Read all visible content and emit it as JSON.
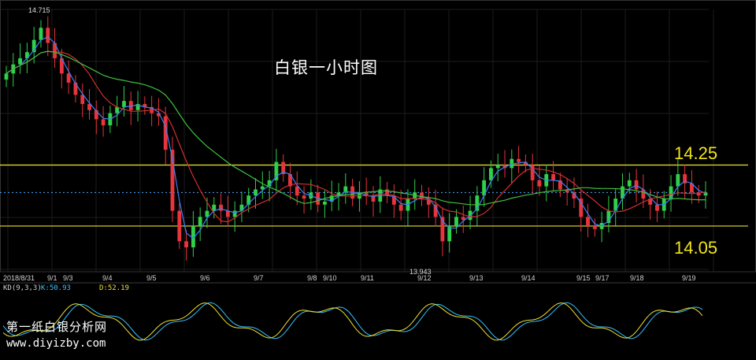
{
  "title": "白银一小时图",
  "levels": {
    "resistance": "14.25",
    "support": "14.05"
  },
  "annotations": {
    "high": "14.715",
    "low": "13.943"
  },
  "kd": {
    "name": "KD(9,3,3)",
    "k": "K:50.93",
    "d": "D:52.19"
  },
  "watermark": {
    "name": "第一纸白银分析网",
    "url": "www.diyizby.com"
  },
  "colors": {
    "up": "#2fd04a",
    "down": "#e8343c",
    "ma_fast": "#3b82f6",
    "ma_mid": "#d32f2f",
    "ma_slow": "#3fbf3f",
    "level_line": "#e6e030",
    "k_line": "#35c3ff",
    "d_line": "#f0e030"
  },
  "chart_data": {
    "type": "line",
    "series_kind": "candlestick",
    "x_tick_labels": [
      "2018/8/31",
      "9/1",
      "9/3",
      "9/4",
      "9/5",
      "9/6",
      "9/7",
      "9/8",
      "9/10",
      "9/11",
      "9/12",
      "9/13",
      "9/14",
      "9/15",
      "9/17",
      "9/18",
      "9/19"
    ],
    "close": [
      14.55,
      14.58,
      14.6,
      14.62,
      14.66,
      14.7,
      14.65,
      14.6,
      14.55,
      14.52,
      14.48,
      14.45,
      14.43,
      14.4,
      14.38,
      14.42,
      14.44,
      14.46,
      14.43,
      14.45,
      14.44,
      14.42,
      14.41,
      14.3,
      14.1,
      14.0,
      13.98,
      14.05,
      14.08,
      14.1,
      14.12,
      14.1,
      14.08,
      14.1,
      14.12,
      14.15,
      14.17,
      14.18,
      14.2,
      14.26,
      14.22,
      14.18,
      14.15,
      14.14,
      14.16,
      14.12,
      14.13,
      14.15,
      14.16,
      14.18,
      14.14,
      14.16,
      14.15,
      14.13,
      14.17,
      14.15,
      14.12,
      14.1,
      14.14,
      14.16,
      14.14,
      14.12,
      14.08,
      14.0,
      14.05,
      14.08,
      14.07,
      14.1,
      14.15,
      14.2,
      14.24,
      14.25,
      14.24,
      14.27,
      14.26,
      14.25,
      14.2,
      14.18,
      14.22,
      14.2,
      14.17,
      14.16,
      14.14,
      14.08,
      14.05,
      14.04,
      14.06,
      14.1,
      14.14,
      14.18,
      14.2,
      14.17,
      14.14,
      14.12,
      14.1,
      14.14,
      14.18,
      14.22,
      14.19,
      14.16,
      14.15,
      14.16
    ],
    "high_label": "14.715",
    "low_label": "13.943",
    "levels": [
      14.25,
      14.05
    ],
    "ylim": [
      13.9,
      14.76
    ]
  }
}
